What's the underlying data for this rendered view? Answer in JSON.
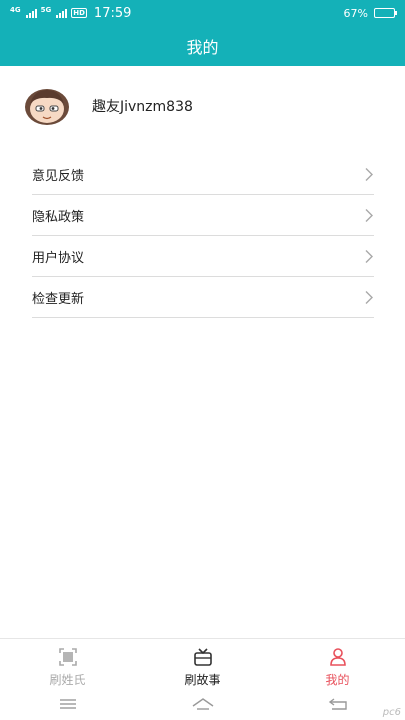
{
  "status_bar": {
    "net1": "4G",
    "net2": "5G",
    "hd": "HD",
    "time": "17:59",
    "battery": "67%",
    "battery_level": 0.67
  },
  "header": {
    "title": "我的"
  },
  "profile": {
    "username": "趣友Jivnzm838"
  },
  "menu": {
    "items": [
      {
        "label": "意见反馈"
      },
      {
        "label": "隐私政策"
      },
      {
        "label": "用户协议"
      },
      {
        "label": "检查更新"
      }
    ]
  },
  "tabbar": {
    "items": [
      {
        "label": "刷姓氏",
        "icon": "scan-icon",
        "state": "inactive"
      },
      {
        "label": "刷故事",
        "icon": "tv-icon",
        "state": "normal"
      },
      {
        "label": "我的",
        "icon": "person-icon",
        "state": "active"
      }
    ],
    "active_color": "#e8505b"
  },
  "watermark": "pc6",
  "colors": {
    "header_bg": "#14b1b8"
  }
}
